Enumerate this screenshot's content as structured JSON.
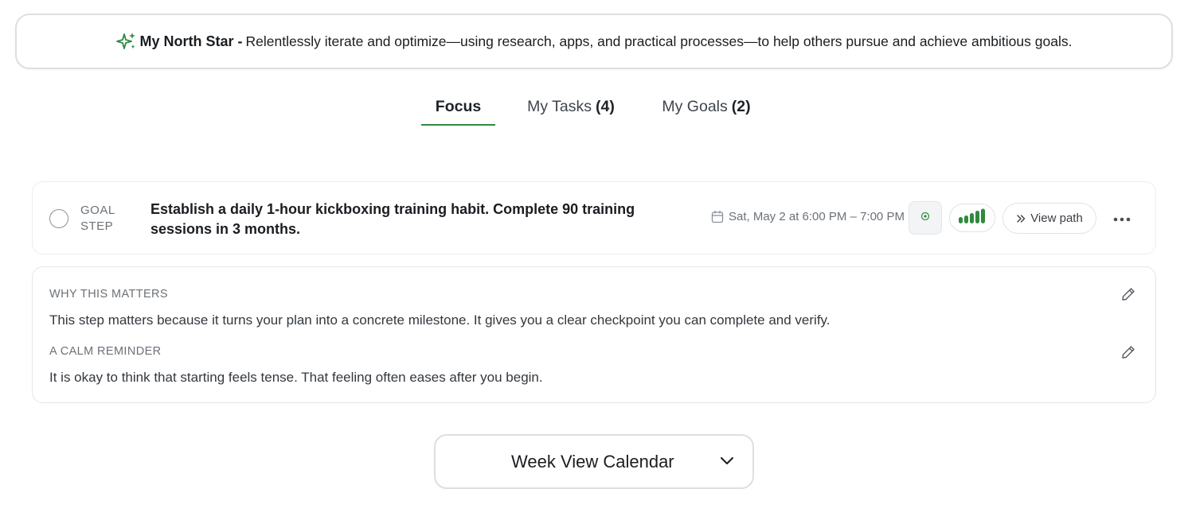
{
  "north_star": {
    "title": "My North Star -",
    "text": "Relentlessly iterate and optimize—using research, apps, and practical processes—to help others pursue and achieve ambitious goals.",
    "icon": "sparkle-icon"
  },
  "tabs": [
    {
      "label": "Focus",
      "count": "",
      "active": true
    },
    {
      "label": "My Tasks",
      "count": "(4)",
      "active": false
    },
    {
      "label": "My Goals",
      "count": "(2)",
      "active": false
    }
  ],
  "goal_card": {
    "type_line1": "GOAL",
    "type_line2": "STEP",
    "title": "Establish a daily 1-hour kickboxing training habit. Complete 90 training sessions in 3 months.",
    "datetime": "Sat, May 2 at 6:00 PM – 7:00 PM",
    "view_path_label": "View path",
    "signal_bars": 5,
    "accent": "#2e8b3e"
  },
  "info_card": {
    "why_label": "WHY THIS MATTERS",
    "why_text": "This step matters because it turns your plan into a concrete milestone. It gives you a clear checkpoint you can complete and verify.",
    "reminder_label": "A CALM REMINDER",
    "reminder_text": "It is okay to think that starting feels tense. That feeling often eases after you begin."
  },
  "calendar": {
    "label": "Week View Calendar"
  },
  "colors": {
    "accent_green": "#2e8b3e",
    "text_dark": "#1a1d21",
    "text_muted": "#6b7178",
    "border": "#dcdfe3"
  }
}
